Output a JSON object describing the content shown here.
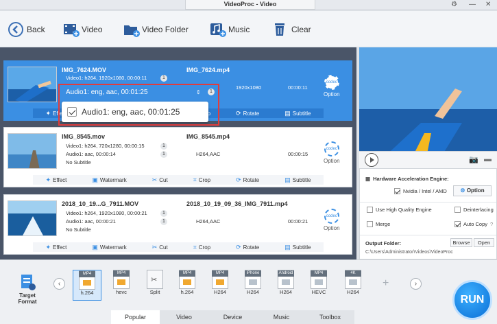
{
  "app": {
    "title": "VideoProc - Video"
  },
  "toolbar": {
    "back": "Back",
    "video": "Video",
    "video_folder": "Video Folder",
    "music": "Music",
    "clear": "Clear"
  },
  "files": [
    {
      "src_name": "IMG_7624.MOV",
      "video_info": "Video1: h264, 1920x1080, 00:00:11",
      "audio_info": "Audio1: eng, aac, 00:01:25",
      "subtitle": "",
      "video_count": "1",
      "audio_count": "1",
      "out_name": "IMG_7624.mp4",
      "out_codec": "",
      "resolution": "1920x1080",
      "duration": "00:00:11"
    },
    {
      "src_name": "IMG_8545.mov",
      "video_info": "Video1: h264, 720x1280, 00:00:15",
      "audio_info": "Audio1: aac, 00:00:14",
      "subtitle": "No Subtitle",
      "video_count": "1",
      "audio_count": "1",
      "out_name": "IMG_8545.mp4",
      "out_codec": "H264,AAC",
      "resolution": "",
      "duration": "00:00:15"
    },
    {
      "src_name": "2018_10_19...G_7911.MOV",
      "video_info": "Video1: h264, 1920x1080, 00:00:21",
      "audio_info": "Audio1: aac, 00:00:21",
      "subtitle": "No Subtitle",
      "video_count": "1",
      "audio_count": "1",
      "out_name": "2018_10_19_09_36_IMG_7911.mp4",
      "out_codec": "H264,AAC",
      "resolution": "",
      "duration": "00:00:21"
    }
  ],
  "actions": {
    "effect": "Effect",
    "watermark": "Watermark",
    "cut": "Cut",
    "crop": "Crop",
    "rotate": "Rotate",
    "subtitle": "Subtitle"
  },
  "option_label": "Option",
  "popup": {
    "item": "Audio1: eng, aac, 00:01:25",
    "checked": true
  },
  "settings": {
    "hw_title": "Hardware Acceleration Engine:",
    "hw_value": "Nvidia / Intel / AMD",
    "hw_option": "Option",
    "high_quality": "Use High Quality Engine",
    "deinterlacing": "Deinterlacing",
    "merge": "Merge",
    "auto_copy": "Auto Copy",
    "output_folder_label": "Output Folder:",
    "browse": "Browse",
    "open": "Open",
    "output_path": "C:\\Users\\Administrator\\Videos\\VideoProc"
  },
  "target_format_label": "Target Format",
  "formats": [
    {
      "tag": "MP4",
      "label": "h.264",
      "active": true
    },
    {
      "tag": "MP4",
      "label": "hevc"
    },
    {
      "tag": "",
      "label": "Split"
    },
    {
      "tag": "MP4",
      "label": "h.264"
    },
    {
      "tag": "MP4",
      "label": "H264"
    },
    {
      "tag": "iPhone",
      "label": "H264"
    },
    {
      "tag": "Android",
      "label": "H264"
    },
    {
      "tag": "MP4",
      "label": "HEVC"
    },
    {
      "tag": "4K",
      "label": "H264"
    }
  ],
  "tabs": [
    "Popular",
    "Video",
    "Device",
    "Music",
    "Toolbox"
  ],
  "run": "RUN",
  "colors": {
    "accent": "#3b8fe3",
    "highlight": "#e23c3c"
  }
}
